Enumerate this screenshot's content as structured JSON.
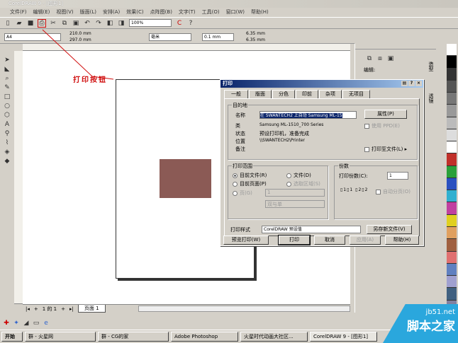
{
  "window": {
    "title": "CorelDRAW 9 - [图形1]"
  },
  "menu": [
    "文件(F)",
    "编辑(E)",
    "视图(V)",
    "版面(L)",
    "安排(A)",
    "效果(C)",
    "点阵图(B)",
    "文字(T)",
    "工具(O)",
    "窗口(W)",
    "帮助(H)"
  ],
  "toolbar": {
    "zoom": "100%"
  },
  "propbar": {
    "paper": "A4",
    "width": "210.0 mm",
    "height": "297.0 mm",
    "units": "毫米",
    "nudge": "0.1 mm",
    "dup_x": "6.35 mm",
    "dup_y": "6.35 mm"
  },
  "callout": {
    "text": "打印按钮",
    "color": "#d01010"
  },
  "shape": {
    "color": "#8b5a55"
  },
  "dialog": {
    "title": "打印",
    "tabs": [
      "一般",
      "版面",
      "分色",
      "印前",
      "杂项",
      "无项目"
    ],
    "destination": {
      "legend": "目的地",
      "name_label": "名称",
      "name_value": "在 SWANTECH2 上自动 Samsung ML-15",
      "properties": "属性(P)",
      "type_label": "类",
      "type_value": "Samsung ML-1510_700 Series",
      "status_label": "状态",
      "status_value": "预设打印机，准备完成",
      "where_label": "位置",
      "where_value": "\\\\SWANTECH2\\Printer",
      "comment_label": "备注",
      "use_ppd": "使用 PPD(E)",
      "print_to_file": "打印至文件(L)"
    },
    "range": {
      "legend": "打印范围",
      "current_doc": "目前文件(R)",
      "documents": "文件(D)",
      "current_page": "目前页面(P)",
      "selection": "选取区域(S)",
      "pages": "页(G)",
      "pages_value": "1",
      "even_odd": "双与单"
    },
    "copies": {
      "legend": "份数",
      "label": "打印份数(C):",
      "value": "1",
      "collate": "自动分页(O)"
    },
    "style_label": "打印样式",
    "style_value": "CorelDRAW 预设值",
    "save_as": "另存新文件(V)",
    "buttons": {
      "preview": "预览打印(W)",
      "print": "打印",
      "cancel": "取消",
      "apply": "应用(A)",
      "help": "帮助(H)"
    }
  },
  "docker": {
    "label": "编辑:",
    "tabs": [
      "造型",
      "透镜"
    ]
  },
  "pagenav": {
    "info": "1 的 1",
    "tab": "页面 1"
  },
  "taskbar": {
    "start": "开始",
    "items": [
      "群 - 火星网",
      "群 - CG的家",
      "Adobe Photoshop",
      "火星时代动画大社区...",
      "CorelDRAW 9 - [图形1]"
    ]
  },
  "watermark": {
    "line1": "jb51.net",
    "line2": "脚本之家"
  }
}
